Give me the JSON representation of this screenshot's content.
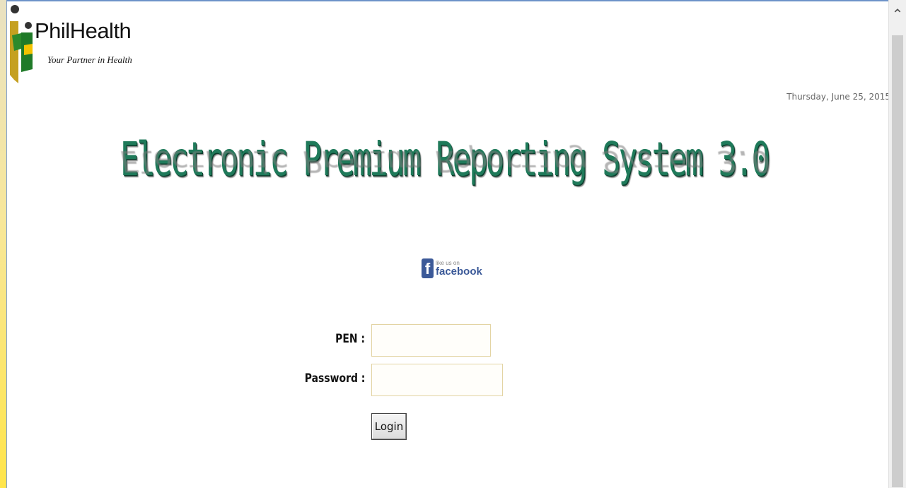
{
  "logo": {
    "name": "PhilHealth",
    "tagline": "Your Partner in Health"
  },
  "date": "Thursday, June 25, 2015",
  "title": "Electronic Premium Reporting System 3.0",
  "facebook": {
    "small": "like us on",
    "big": "facebook"
  },
  "form": {
    "pen_label": "PEN :",
    "password_label": "Password :",
    "pen_value": "",
    "password_value": "",
    "login_label": "Login"
  },
  "colors": {
    "title": "#1f7a5a",
    "facebook": "#3b5998",
    "strip": "#ffe54a"
  }
}
